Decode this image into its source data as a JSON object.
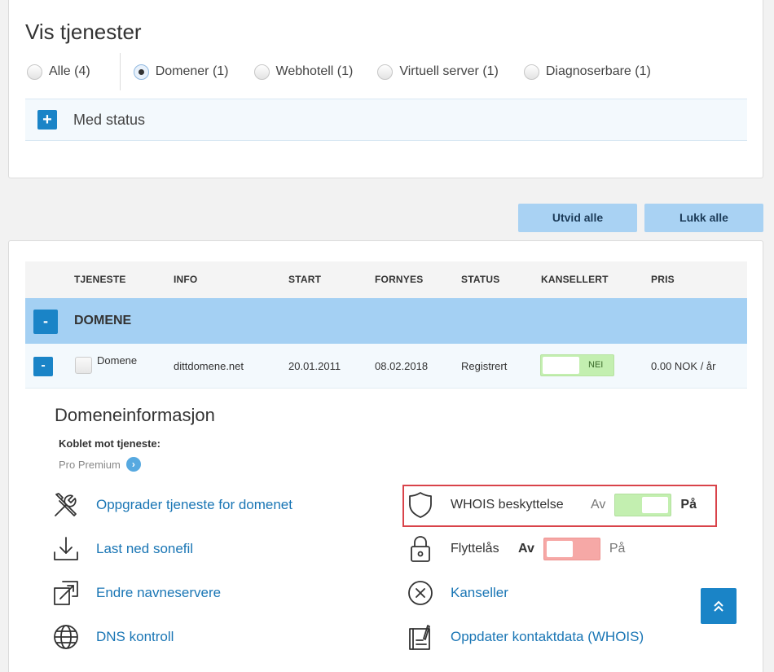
{
  "filter": {
    "title": "Vis tjenester",
    "options": [
      {
        "label": "Alle (4)",
        "selected": false
      },
      {
        "label": "Domener (1)",
        "selected": true
      },
      {
        "label": "Webhotell (1)",
        "selected": false
      },
      {
        "label": "Virtuell server (1)",
        "selected": false
      },
      {
        "label": "Diagnoserbare (1)",
        "selected": false
      }
    ],
    "status_plus": "+",
    "status_label": "Med status"
  },
  "toolbar": {
    "expand_all": "Utvid alle",
    "collapse_all": "Lukk alle"
  },
  "table": {
    "headers": [
      "TJENESTE",
      "INFO",
      "START",
      "FORNYES",
      "STATUS",
      "KANSELLERT",
      "PRIS"
    ],
    "group": {
      "toggle": "-",
      "title": "DOMENE"
    },
    "row": {
      "toggle": "-",
      "service": "Domene",
      "info": "dittdomene.net",
      "start": "20.01.2011",
      "renews": "08.02.2018",
      "status": "Registrert",
      "cancelled": "NEI",
      "price": "0.00 NOK / år"
    }
  },
  "domain_info": {
    "title": "Domeneinformasjon",
    "linked_label": "Koblet mot tjeneste:",
    "linked_value": "Pro Premium",
    "linked_chevron": "›",
    "actions": {
      "upgrade": "Oppgrader tjeneste for domenet",
      "download_zone": "Last ned sonefil",
      "change_ns": "Endre navneservere",
      "dns": "DNS kontroll",
      "cancel": "Kanseller",
      "update_contact": "Oppdater kontaktdata (WHOIS)"
    },
    "whois": {
      "label": "WHOIS beskyttelse",
      "off": "Av",
      "on": "På",
      "state": "on"
    },
    "transfer_lock": {
      "label": "Flyttelås",
      "off": "Av",
      "on": "På",
      "state": "off"
    }
  },
  "colors": {
    "accent": "#1a84c7",
    "link": "#1a76b5",
    "group_row": "#a4d0f3",
    "toggle_on": "#c3efb0",
    "toggle_off": "#f6a8a6",
    "highlight": "#d9434a"
  }
}
